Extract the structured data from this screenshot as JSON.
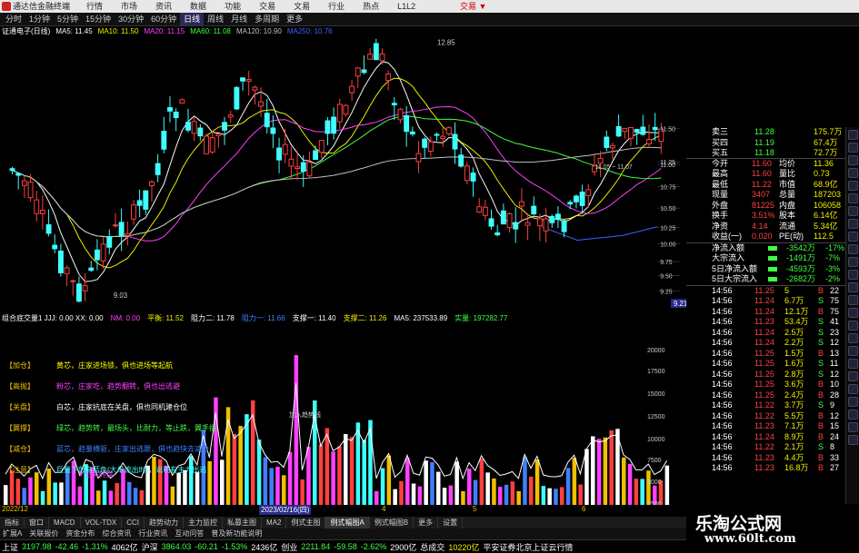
{
  "titlebar": {
    "app_title": "通达信金融终端",
    "menu": [
      "行情",
      "市场",
      "资讯",
      "数据",
      "功能",
      "交易",
      "文易",
      "行业",
      "热点",
      "L1L2"
    ],
    "right_label": "交易 ▼"
  },
  "periods": [
    "分时",
    "1分钟",
    "5分钟",
    "15分钟",
    "30分钟",
    "60分钟",
    "日线",
    "周线",
    "月线",
    "多周期",
    "更多"
  ],
  "active_period": "日线",
  "info": {
    "name": "证通电子(日线)",
    "ma5": "MA5: 11.45",
    "ma10": "MA10: 11.50",
    "ma20": "MA20: 11.15",
    "ma60": "MA60: 11.08",
    "ma120": "MA120: 10.90",
    "ma250": "MA250: 10.76"
  },
  "price_labels": {
    "high": "12.85",
    "low": "9.03",
    "mark1": "11.05 ~ 11.07",
    "cur": "9.21"
  },
  "price_axis": [
    "11.50",
    "11.25",
    "11.00",
    "10.75",
    "10.50",
    "10.25",
    "10.00",
    "9.75",
    "9.50",
    "9.25"
  ],
  "indicator_bar": {
    "name": "组合底交量1 JJJ: 0.00 XX: 0.00",
    "nm": "NM: 0.00",
    "pinghen": "平衡: 11.52",
    "zuli2": "阻力二: 11.78",
    "zuli1": "阻力一: 11.66",
    "zhicheng1": "支撑一: 11.40",
    "zhicheng2": "支撑二: 11.26",
    "ma5": "MA5: 237533.89",
    "shiliang": "实量: 197282.77"
  },
  "legend": [
    {
      "tag": "【加仓】",
      "text": "黄芯，庄家进场锁，俱也进场等起航",
      "color": "#ffff00"
    },
    {
      "tag": "【高抛】",
      "text": "粉芯，庄家吃，趋势翻转，俱也出逃避",
      "color": "#ff40ff"
    },
    {
      "tag": "【关盘】",
      "text": "白芯，庄家抗底在关盘，俱也同机建仓位",
      "color": "#ffffff"
    },
    {
      "tag": "【翼撑】",
      "text": "绿芯，趋势转，最场头，比耐力，等止跌，翼手指",
      "color": "#40ff40"
    },
    {
      "tag": "【减仓】",
      "text": "蓝芯，趋量横驱，庄家出逃跟，俱也趋快去减仓",
      "color": "#4080ff"
    },
    {
      "tag": "【注意】",
      "text": "巨量下部有蓝色(大单流出时)，说明有主力出逃",
      "color": "#40ffff"
    }
  ],
  "vol_axis": [
    "20000",
    "17500",
    "15000",
    "12500",
    "10000",
    "7500",
    "5000",
    "2500"
  ],
  "vol_labels": {
    "kong": "▼空头转盘",
    "jiaru": "加入趋势线"
  },
  "dates": {
    "d1": "2022/12",
    "d2": "2023/02/16(四)",
    "d3": "4",
    "d4": "5",
    "d5": "6"
  },
  "bottom_tabs": [
    "指标",
    "窗口",
    "MACD",
    "VOL-TDX",
    "CCI",
    "趋势动力",
    "主力监控",
    "私募主图",
    "MA2",
    "例式主图",
    "例式幅图A",
    "例式幅图B",
    "更多",
    "设置"
  ],
  "active_bottom_tab": "例式幅图A",
  "sub_tabs": [
    "扩展A",
    "关联报价",
    "资金分布",
    "综合资讯",
    "行业资讯",
    "互动问答",
    "普及新功能说明"
  ],
  "quote": {
    "sell3": {
      "label": "卖三",
      "price": "11.28",
      "vol": "175.7万"
    },
    "sell4": {
      "label": "买四",
      "price": "11.19",
      "vol": "67.4万"
    },
    "sell5": {
      "label": "买五",
      "price": "11.18",
      "vol": "72.7万"
    },
    "rows": [
      {
        "l1": "今开",
        "v1": "11.60",
        "l2": "均价",
        "v2": "11.36"
      },
      {
        "l1": "最高",
        "v1": "11.60",
        "l2": "量比",
        "v2": "0.73"
      },
      {
        "l1": "最低",
        "v1": "11.22",
        "l2": "市值",
        "v2": "68.9亿"
      },
      {
        "l1": "现量",
        "v1": "3407",
        "l2": "总量",
        "v2": "187203"
      },
      {
        "l1": "外盘",
        "v1": "81225",
        "l2": "内盘",
        "v2": "106058"
      },
      {
        "l1": "换手",
        "v1": "3.51%",
        "l2": "股本",
        "v2": "6.14亿"
      },
      {
        "l1": "净资",
        "v1": "4.14",
        "l2": "流通",
        "v2": "5.34亿"
      },
      {
        "l1": "收益(一)",
        "v1": "0.020",
        "l2": "PE(动)",
        "v2": "112.5"
      }
    ],
    "flows": [
      {
        "label": "净流入额",
        "val": "-3542万",
        "pct": "-17%"
      },
      {
        "label": "大宗流入",
        "val": "-1491万",
        "pct": "-7%"
      },
      {
        "label": "5日净流入额",
        "val": "-4593万",
        "pct": "-3%"
      },
      {
        "label": "5日大宗流入",
        "val": "-2682万",
        "pct": "-2%"
      }
    ],
    "ticks": [
      {
        "t": "14:56",
        "p": "11.25",
        "v": "5",
        "f": "B",
        "n": "22"
      },
      {
        "t": "14:56",
        "p": "11.24",
        "v": "6.7万",
        "f": "S",
        "n": "75"
      },
      {
        "t": "14:56",
        "p": "11.24",
        "v": "12.1万",
        "f": "B",
        "n": "75"
      },
      {
        "t": "14:56",
        "p": "11.23",
        "v": "53.4万",
        "f": "S",
        "n": "41"
      },
      {
        "t": "14:56",
        "p": "11.24",
        "v": "2.5万",
        "f": "S",
        "n": "23"
      },
      {
        "t": "14:56",
        "p": "11.24",
        "v": "2.2万",
        "f": "S",
        "n": "12"
      },
      {
        "t": "14:56",
        "p": "11.25",
        "v": "1.5万",
        "f": "B",
        "n": "13"
      },
      {
        "t": "14:56",
        "p": "11.25",
        "v": "1.6万",
        "f": "S",
        "n": "11"
      },
      {
        "t": "14:56",
        "p": "11.25",
        "v": "2.8万",
        "f": "S",
        "n": "12"
      },
      {
        "t": "14:56",
        "p": "11.25",
        "v": "3.6万",
        "f": "B",
        "n": "10"
      },
      {
        "t": "14:56",
        "p": "11.25",
        "v": "2.4万",
        "f": "B",
        "n": "28"
      },
      {
        "t": "14:56",
        "p": "11.22",
        "v": "3.7万",
        "f": "S",
        "n": "9"
      },
      {
        "t": "14:56",
        "p": "11.22",
        "v": "5.5万",
        "f": "B",
        "n": "12"
      },
      {
        "t": "14:56",
        "p": "11.23",
        "v": "7.1万",
        "f": "B",
        "n": "15"
      },
      {
        "t": "14:56",
        "p": "11.24",
        "v": "8.9万",
        "f": "B",
        "n": "24"
      },
      {
        "t": "14:56",
        "p": "11.22",
        "v": "2.1万",
        "f": "S",
        "n": "8"
      },
      {
        "t": "14:56",
        "p": "11.23",
        "v": "4.4万",
        "f": "B",
        "n": "33"
      },
      {
        "t": "14:56",
        "p": "11.23",
        "v": "16.8万",
        "f": "B",
        "n": "27"
      }
    ]
  },
  "index_bar": {
    "sh_label": "上证",
    "sh_val": "3197.98",
    "sh_chg": "-42.46",
    "sh_pct": "-1.31%",
    "sh_amt": "4062亿",
    "sz_label": "沪深",
    "sz_val": "3864.03",
    "sz_chg": "-60.21",
    "sz_pct": "-1.53%",
    "sz_amt": "2436亿",
    "cy_label": "创业",
    "cy_val": "2211.84",
    "cy_chg": "-59.58",
    "cy_pct": "-2.62%",
    "cy_amt": "2900亿",
    "total_label": "总成交",
    "total_val": "10220亿",
    "extra": "平安证券北京上证云行情"
  },
  "watermark": {
    "cn": "乐淘公式网",
    "url": "www.60lt.com"
  },
  "colors": {
    "up": "#ff4040",
    "down": "#40ffff",
    "ma5": "#ffffff",
    "ma10": "#f0f000",
    "ma20": "#ff40ff",
    "ma60": "#40ff40",
    "ma120": "#c0c0c0",
    "ma250": "#4060ff"
  }
}
